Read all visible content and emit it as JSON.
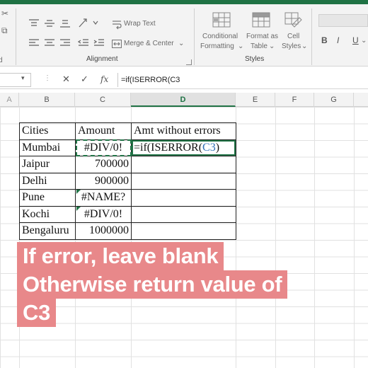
{
  "ribbon": {
    "wrap_text": "Wrap Text",
    "merge_center": "Merge & Center",
    "conditional_formatting": [
      "Conditional",
      "Formatting"
    ],
    "format_as_table": [
      "Format as",
      "Table"
    ],
    "cell_styles": [
      "Cell",
      "Styles"
    ],
    "groups": {
      "alignment": "Alignment",
      "styles": "Styles"
    },
    "buttons": {
      "bold": "B",
      "italic": "I",
      "underline": "U"
    },
    "icons": [
      "align-top-icon",
      "align-middle-icon",
      "align-bottom-icon",
      "orientation-icon",
      "align-left-icon",
      "align-center-icon",
      "align-right-icon",
      "decrease-indent-icon",
      "increase-indent-icon",
      "wrap-text-icon",
      "merge-center-icon",
      "conditional-formatting-icon",
      "format-as-table-icon",
      "cell-styles-icon"
    ]
  },
  "formula_bar": {
    "cancel": "✕",
    "enter": "✓",
    "fx": "fx",
    "formula": "=if(ISERROR(C3"
  },
  "columns": [
    "B",
    "C",
    "D",
    "E",
    "F",
    "G"
  ],
  "active_column": "D",
  "table": {
    "headers": [
      "Cities",
      "Amount",
      "Amt without errors"
    ],
    "rows": [
      {
        "city": "Mumbai",
        "amount": "#DIV/0!",
        "result_prefix": "=if(ISERROR(",
        "result_ref": "C3",
        "result_suffix": ")"
      },
      {
        "city": "Jaipur",
        "amount": "700000",
        "result": ""
      },
      {
        "city": "Delhi",
        "amount": "900000",
        "result": ""
      },
      {
        "city": "Pune",
        "amount": "#NAME?",
        "result": ""
      },
      {
        "city": "Kochi",
        "amount": "#DIV/0!",
        "result": ""
      },
      {
        "city": "Bengaluru",
        "amount": "1000000",
        "result": ""
      }
    ]
  },
  "caption": {
    "lines": [
      "If error, leave blank",
      "Otherwise return value of",
      "C3"
    ]
  },
  "colors": {
    "excel_green": "#217346",
    "caption_bg": "#e8888a",
    "cell_ref_blue": "#2f6fb7"
  }
}
